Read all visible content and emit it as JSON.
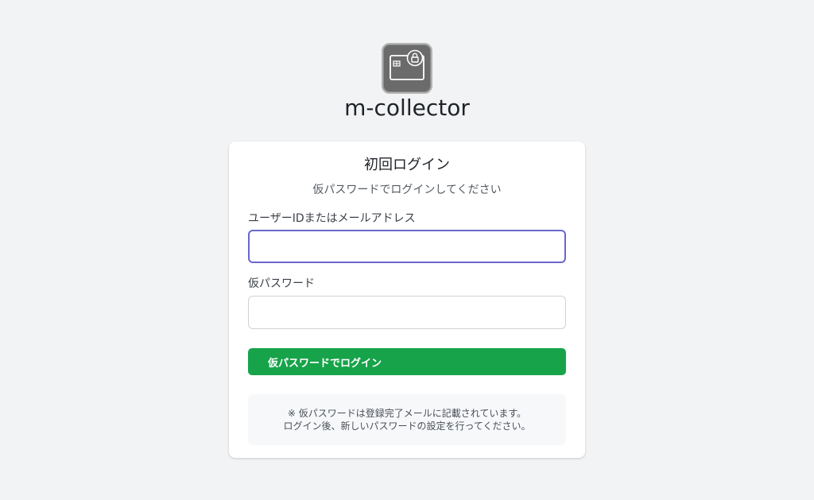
{
  "app": {
    "name": "m-collector",
    "logo_icon": "card-lock-icon"
  },
  "login": {
    "title": "初回ログイン",
    "subtitle": "仮パスワードでログインしてください",
    "user_label": "ユーザーIDまたはメールアドレス",
    "user_value": "",
    "password_label": "仮パスワード",
    "password_value": "",
    "submit_label": "仮パスワードでログイン"
  },
  "note": {
    "line1": "※ 仮パスワードは登録完了メールに記載されています。",
    "line2": "ログイン後、新しいパスワードの設定を行ってください。"
  },
  "colors": {
    "background": "#f2f3f5",
    "primary_button": "#17a34a",
    "focus_border": "#6b67cf",
    "logo_bg": "#6b6b6b"
  }
}
